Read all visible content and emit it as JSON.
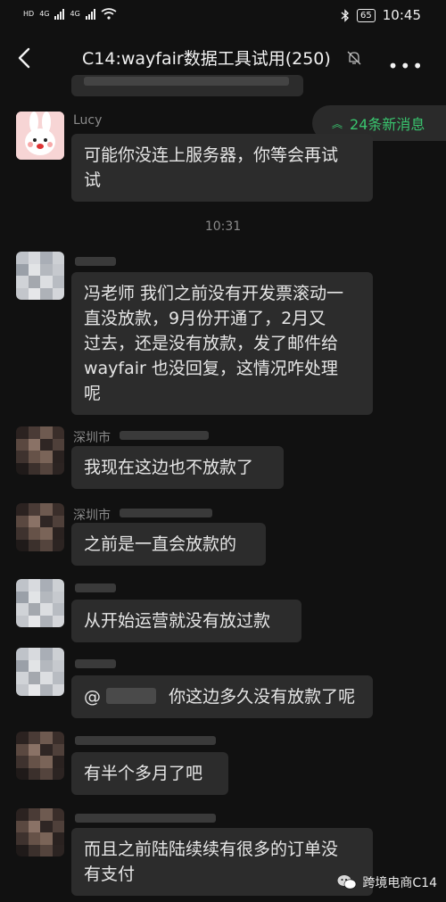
{
  "status": {
    "left_labels": [
      "HD",
      "HD",
      "4G",
      "4G"
    ],
    "battery": "65",
    "time": "10:45"
  },
  "header": {
    "title": "C14:wayfair数据工具试用(250)"
  },
  "banner": {
    "new_messages": "24条新消息"
  },
  "chat": {
    "timestamp": "10:31",
    "messages": [
      {
        "name": "Lucy",
        "text": [
          "可能你没连上服务器，你等会再试",
          "试"
        ]
      },
      {
        "name": "",
        "text": [
          "冯老师 我们之前没有开发票滚动一",
          "直没放款，9月份开通了，2月又",
          "过去，还是没有放款，发了邮件给",
          "wayfair 也没回复，这情况咋处理",
          "呢"
        ]
      },
      {
        "name": "深圳市",
        "text": [
          "我现在这边也不放款了"
        ]
      },
      {
        "name": "深圳市",
        "text": [
          "之前是一直会放款的"
        ]
      },
      {
        "name": "",
        "text": [
          "从开始运营就没有放过款"
        ]
      },
      {
        "name": "",
        "mention": "@",
        "text": [
          "你这边多久没有放款了呢"
        ]
      },
      {
        "name": "",
        "text": [
          "有半个多月了吧"
        ]
      },
      {
        "name": "",
        "text": [
          "而且之前陆陆续续有很多的订单没",
          "有支付"
        ]
      }
    ]
  },
  "watermark": {
    "label": "跨境电商C14"
  },
  "colors": {
    "background": "#111111",
    "bubble": "#2c2c2c",
    "accent_green": "#39c46e",
    "meta_text": "#8a8a8a"
  },
  "icons": [
    "back-arrow-icon",
    "mute-bell-icon",
    "more-dots-icon",
    "bluetooth-icon",
    "wifi-icon",
    "chevron-up-icon",
    "wechat-logo-icon"
  ]
}
